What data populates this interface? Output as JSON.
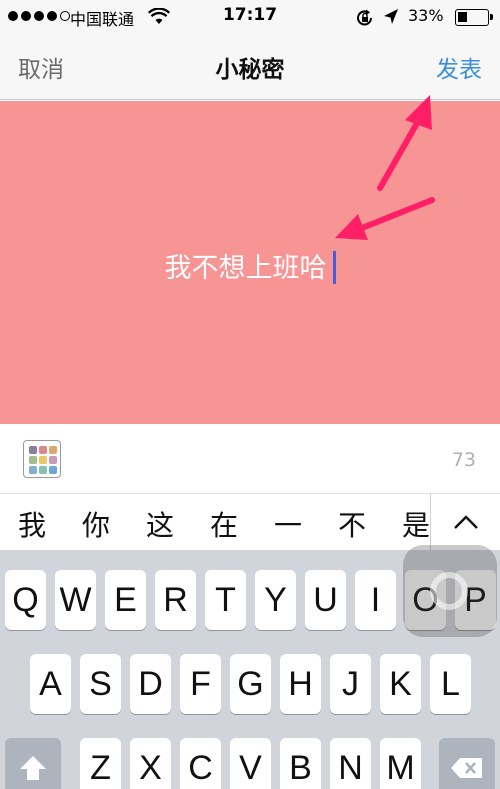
{
  "status_bar": {
    "carrier": "中国联通",
    "time": "17:17",
    "battery": "33%",
    "battery_level": 0.33
  },
  "nav": {
    "cancel_label": "取消",
    "title": "小秘密",
    "publish_label": "发表"
  },
  "compose": {
    "text": "我不想上班哈",
    "background_color": "#f79494",
    "annotation_color": "#ff1f66"
  },
  "tools": {
    "palette_icon": "color-palette-icon",
    "char_count": "73"
  },
  "candidates": [
    "我",
    "你",
    "这",
    "在",
    "一",
    "不",
    "是"
  ],
  "keyboard": {
    "row1": [
      "Q",
      "W",
      "E",
      "R",
      "T",
      "Y",
      "U",
      "I",
      "O",
      "P"
    ],
    "row2": [
      "A",
      "S",
      "D",
      "F",
      "G",
      "H",
      "J",
      "K",
      "L"
    ],
    "row3": [
      "Z",
      "X",
      "C",
      "V",
      "B",
      "N",
      "M"
    ],
    "shift_icon": "shift-icon",
    "delete_icon": "delete-icon"
  }
}
